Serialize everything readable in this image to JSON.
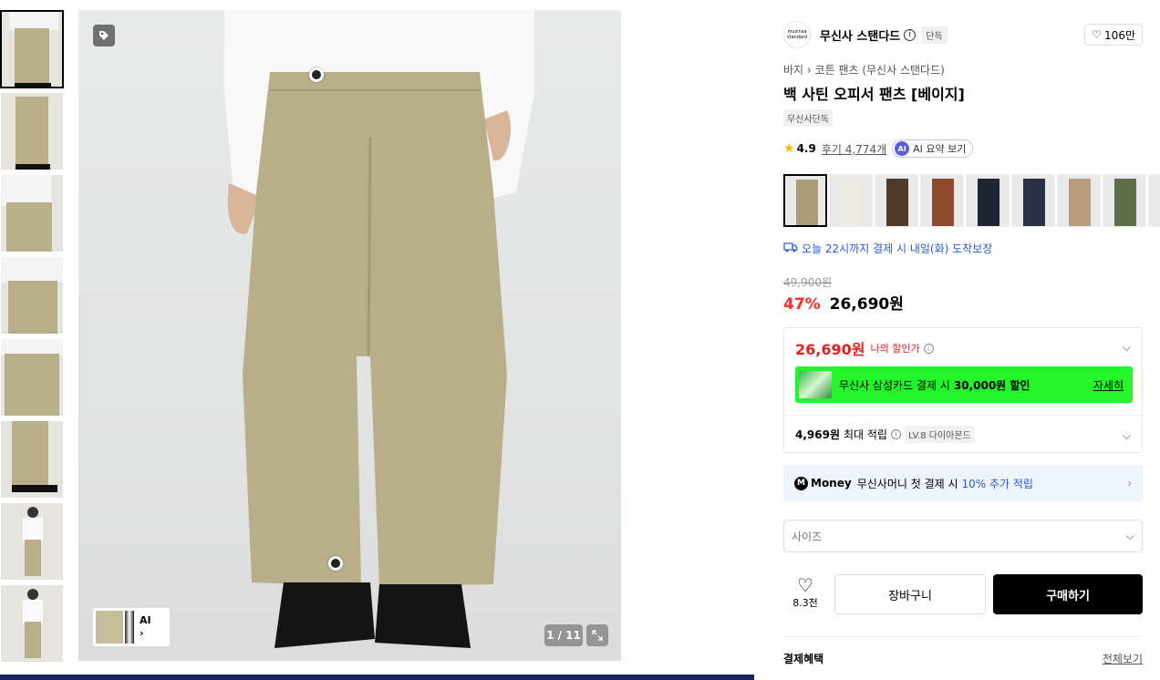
{
  "gallery": {
    "counter": "1 / 11",
    "ai_label": "AI"
  },
  "brand": {
    "logo_text": "musinsa standard",
    "name": "무신사 스탠다드",
    "exclusive_badge": "단독",
    "likes": "106만"
  },
  "product": {
    "breadcrumb": [
      "바지",
      "코튼 팬츠 (무신사 스탠다드)"
    ],
    "title": "백 사틴 오피서 팬츠 [베이지]",
    "exclusive_tag": "무신사단독",
    "rating": "4.9",
    "reviews": "후기 4,774개",
    "ai_summary_label": "AI 요약 보기",
    "ai_icon_text": "AI"
  },
  "color_options": [
    {
      "name": "베이지",
      "color": "#a99e78"
    },
    {
      "name": "화이트",
      "color": "#ecebe3"
    },
    {
      "name": "다크 브라운",
      "color": "#4e3a2a"
    },
    {
      "name": "브라운",
      "color": "#8f4a2e"
    },
    {
      "name": "네이비",
      "color": "#1f2535"
    },
    {
      "name": "다크 네이비",
      "color": "#2a3147"
    },
    {
      "name": "라이트 베이지",
      "color": "#b89c7e"
    },
    {
      "name": "카키",
      "color": "#5d6e48"
    },
    {
      "name": "기타",
      "color": "#bbbbbb"
    }
  ],
  "delivery": {
    "text": "오늘 22시까지 결제 시 내일(화) 도착보장"
  },
  "pricing": {
    "original": "49,900원",
    "discount_percent": "47%",
    "sale": "26,690원",
    "my_price": "26,690원",
    "my_price_label": "나의 할인가",
    "card_promo_text": "무신사 삼성카드 결제 시",
    "card_promo_amount": "30,000원 할인",
    "card_promo_link": "자세히",
    "points_amount": "4,969원",
    "points_label": "최대 적립",
    "level_badge": "LV.8 다이아몬드"
  },
  "money": {
    "brand": "Money",
    "text": "무신사머니 첫 결제 시",
    "highlight": "10% 추가 적립"
  },
  "purchase": {
    "size_placeholder": "사이즈",
    "wish_count": "8.3천",
    "cart_label": "장바구니",
    "buy_label": "구매하기"
  },
  "benefits": {
    "title": "결제혜택",
    "view_all": "전체보기"
  },
  "colors": {
    "accent_red": "#ff2a2a",
    "promo_green": "#22f52a",
    "link_blue": "#2a5bd7",
    "pants_beige": "#b8ae8a"
  }
}
